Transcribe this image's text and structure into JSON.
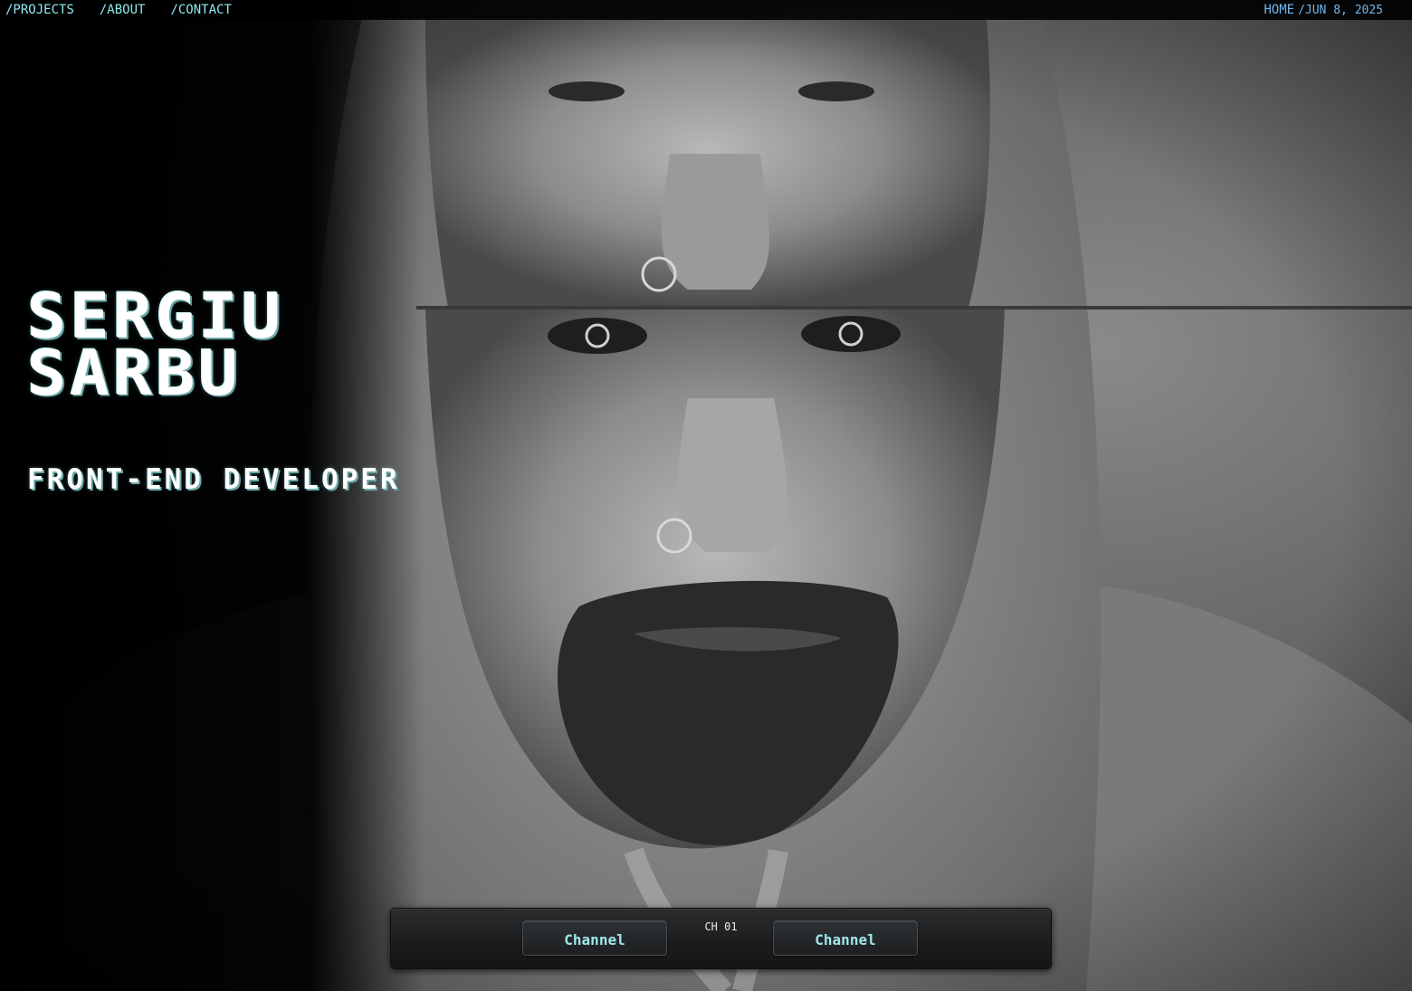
{
  "nav": {
    "links": [
      "/PROJECTS",
      "/ABOUT",
      "/CONTACT"
    ],
    "home_label": "HOME",
    "date": "/JUN 8, 2025"
  },
  "hero": {
    "name_line1": "SERGIU",
    "name_line2": "SARBU",
    "role": "FRONT-END DEVELOPER"
  },
  "controls": {
    "left_button": "Channel",
    "right_button": "Channel",
    "channel_indicator": "CH 01"
  },
  "colors": {
    "accent": "#8ee9ef",
    "nav_right": "#6fb6f0",
    "background": "#000000"
  },
  "icons": {
    "background": "portrait-photo"
  }
}
